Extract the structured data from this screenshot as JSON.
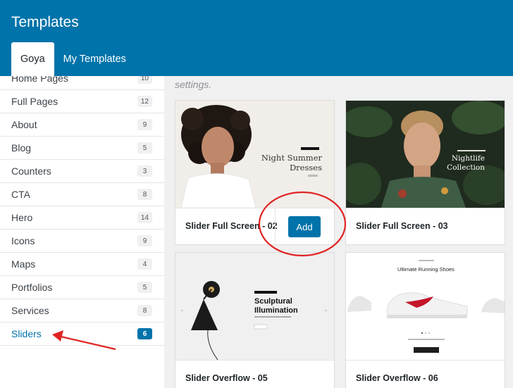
{
  "header": {
    "title": "Templates",
    "tabs": [
      {
        "label": "Goya",
        "active": true
      },
      {
        "label": "My Templates",
        "active": false
      }
    ]
  },
  "sidebar": {
    "categories": [
      {
        "label": "Home Pages",
        "count": "10"
      },
      {
        "label": "Full Pages",
        "count": "12"
      },
      {
        "label": "About",
        "count": "9"
      },
      {
        "label": "Blog",
        "count": "5"
      },
      {
        "label": "Counters",
        "count": "3"
      },
      {
        "label": "CTA",
        "count": "8"
      },
      {
        "label": "Hero",
        "count": "14"
      },
      {
        "label": "Icons",
        "count": "9"
      },
      {
        "label": "Maps",
        "count": "4"
      },
      {
        "label": "Portfolios",
        "count": "5"
      },
      {
        "label": "Services",
        "count": "8"
      },
      {
        "label": "Sliders",
        "count": "6",
        "active": true
      }
    ]
  },
  "main": {
    "intro_text": "settings.",
    "templates": [
      {
        "name": "Slider Full Screen - 02",
        "thumb_heading": "Night Summer Dresses",
        "thumb_line1": "Night Summer",
        "thumb_line2": "Dresses",
        "add_label": "Add"
      },
      {
        "name": "Slider Full Screen - 03",
        "thumb_line1": "Nightlife",
        "thumb_line2": "Collection"
      },
      {
        "name": "Slider Overflow - 05",
        "thumb_line1": "Sculptural",
        "thumb_line2": "Illumination"
      },
      {
        "name": "Slider Overflow - 06",
        "thumb_heading": "Ultimate Running Shoes"
      }
    ]
  },
  "colors": {
    "header_bg": "#0073aa",
    "accent": "#0073aa",
    "annotation_red": "#e02424"
  }
}
